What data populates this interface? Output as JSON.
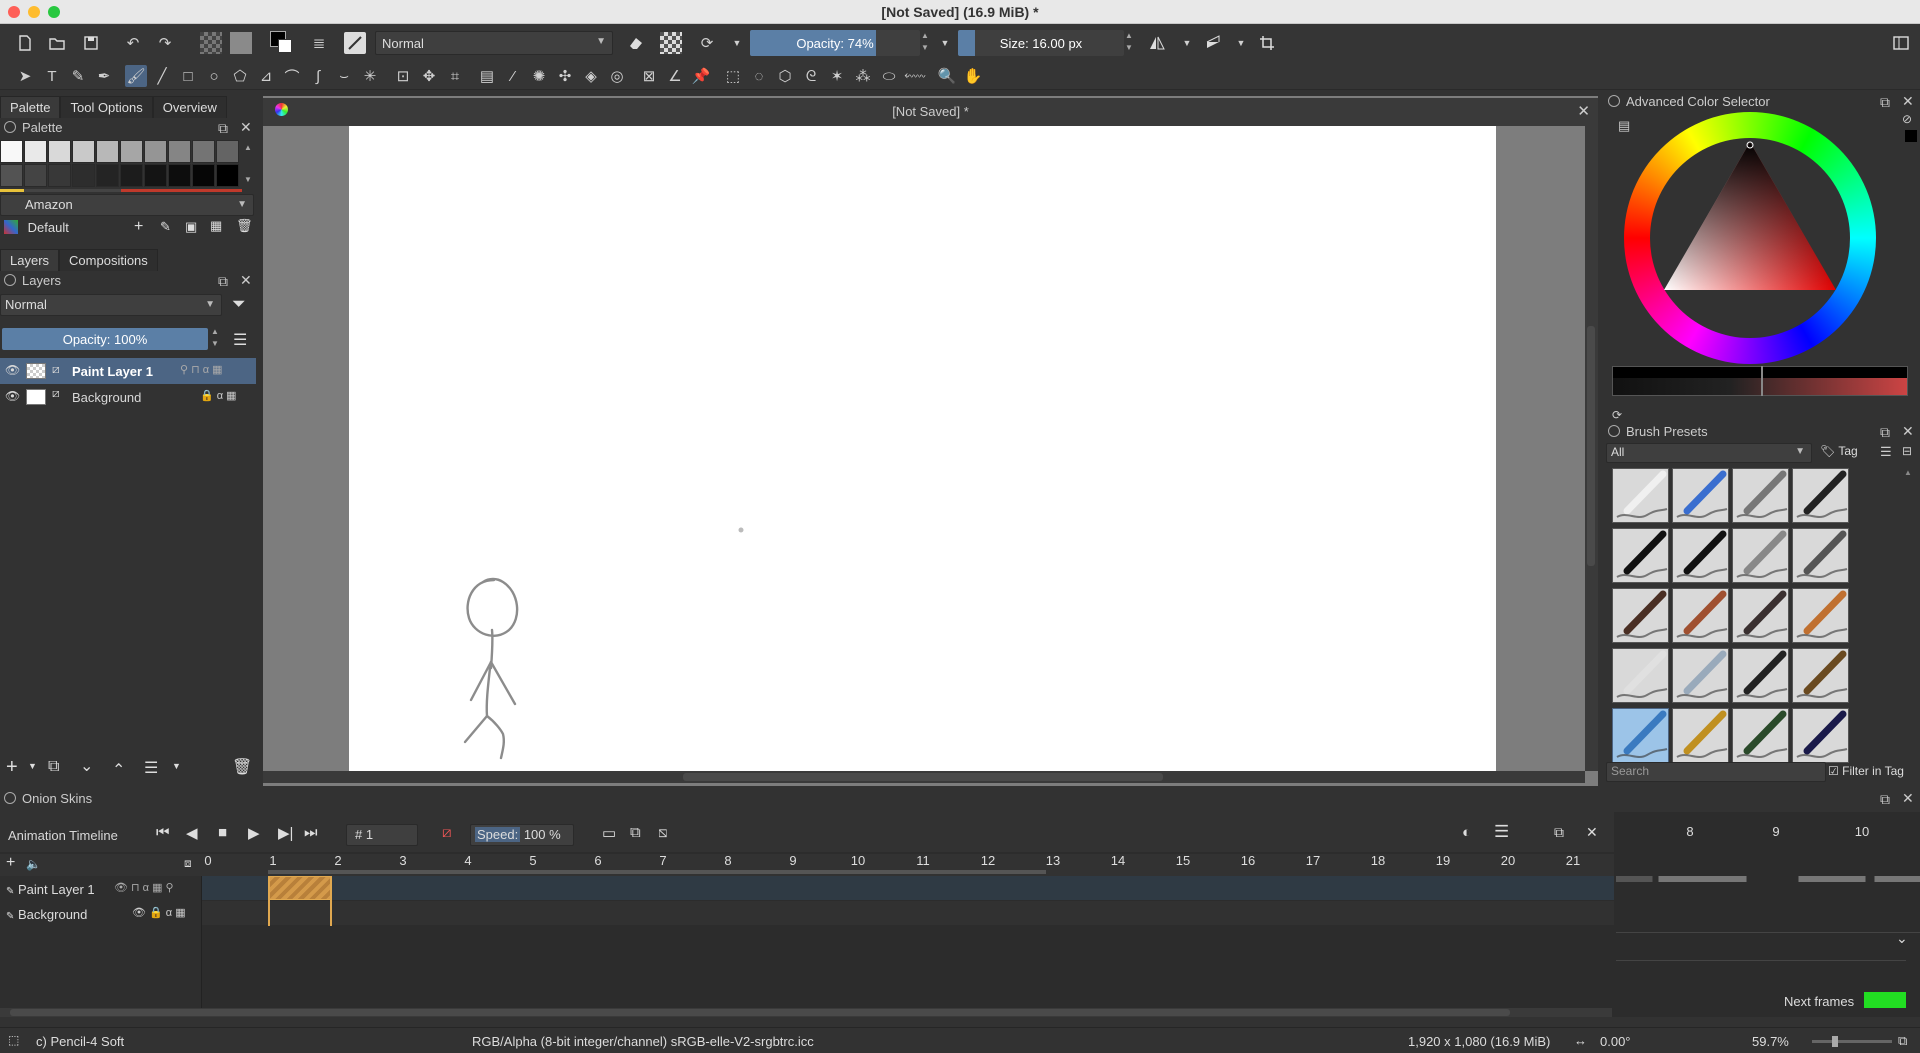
{
  "window": {
    "title": "[Not Saved]  (16.9 MiB)  *"
  },
  "toolbar": {
    "blend_mode": "Normal",
    "opacity": {
      "label": "Opacity: 74%",
      "value": 0.74
    },
    "size": {
      "label": "Size: 16.00 px",
      "value": 0.1
    }
  },
  "left_dock": {
    "tabs": [
      "Palette",
      "Tool Options",
      "Overview"
    ],
    "palette_title": "Palette",
    "palette_name": "Amazon",
    "palette_set": "Default",
    "swatch_colors": [
      "#f8f8f8",
      "#e9e9e9",
      "#d9d9d9",
      "#c9c9c9",
      "#b8b8b8",
      "#a6a6a6",
      "#959595",
      "#858585",
      "#747474",
      "#646464",
      "#535353",
      "#444444",
      "#383838",
      "#2d2d2d",
      "#242424",
      "#1c1c1c",
      "#141414",
      "#0d0d0d",
      "#060606",
      "#000000"
    ],
    "layer_tabs": [
      "Layers",
      "Compositions"
    ],
    "layers_title": "Layers",
    "layer_blend": "Normal",
    "layer_opacity": {
      "label": "Opacity:  100%",
      "value": 1.0
    },
    "layers": [
      {
        "name": "Paint Layer 1",
        "selected": true
      },
      {
        "name": "Background",
        "selected": false
      }
    ]
  },
  "document": {
    "tab_title": "[Not Saved]  *"
  },
  "right_dock": {
    "color_selector_title": "Advanced Color Selector",
    "brush_presets_title": "Brush Presets",
    "brush_filter": "All",
    "tag_label": "Tag",
    "search_placeholder": "Search",
    "filter_in_tag": "Filter in Tag"
  },
  "timeline": {
    "onion_title": "Onion Skins",
    "animation_title": "Animation Timeline",
    "frame_field": "# 1",
    "speed_label": "Speed:",
    "speed_value": "100 %",
    "frame_numbers": [
      "0",
      "1",
      "2",
      "3",
      "4",
      "5",
      "6",
      "7",
      "8",
      "9",
      "10",
      "11",
      "12",
      "13",
      "14",
      "15",
      "16",
      "17",
      "18",
      "19",
      "20",
      "21"
    ],
    "onion_frame_numbers": [
      "8",
      "9",
      "10"
    ],
    "tracks": [
      "Paint Layer 1",
      "Background"
    ],
    "next_frames_label": "Next frames",
    "next_frames_color": "#22dd22"
  },
  "status": {
    "brush": "c) Pencil-4 Soft",
    "color_model": "RGB/Alpha (8-bit integer/channel)  sRGB-elle-V2-srgbtrc.icc",
    "image_size": "1,920 x 1,080 (16.9 MiB)",
    "rotation": "0.00°",
    "zoom": "59.7%"
  },
  "colors": {
    "accent": "#4c6584",
    "fg_color": "#000000",
    "bg_color": "#ffffff"
  }
}
